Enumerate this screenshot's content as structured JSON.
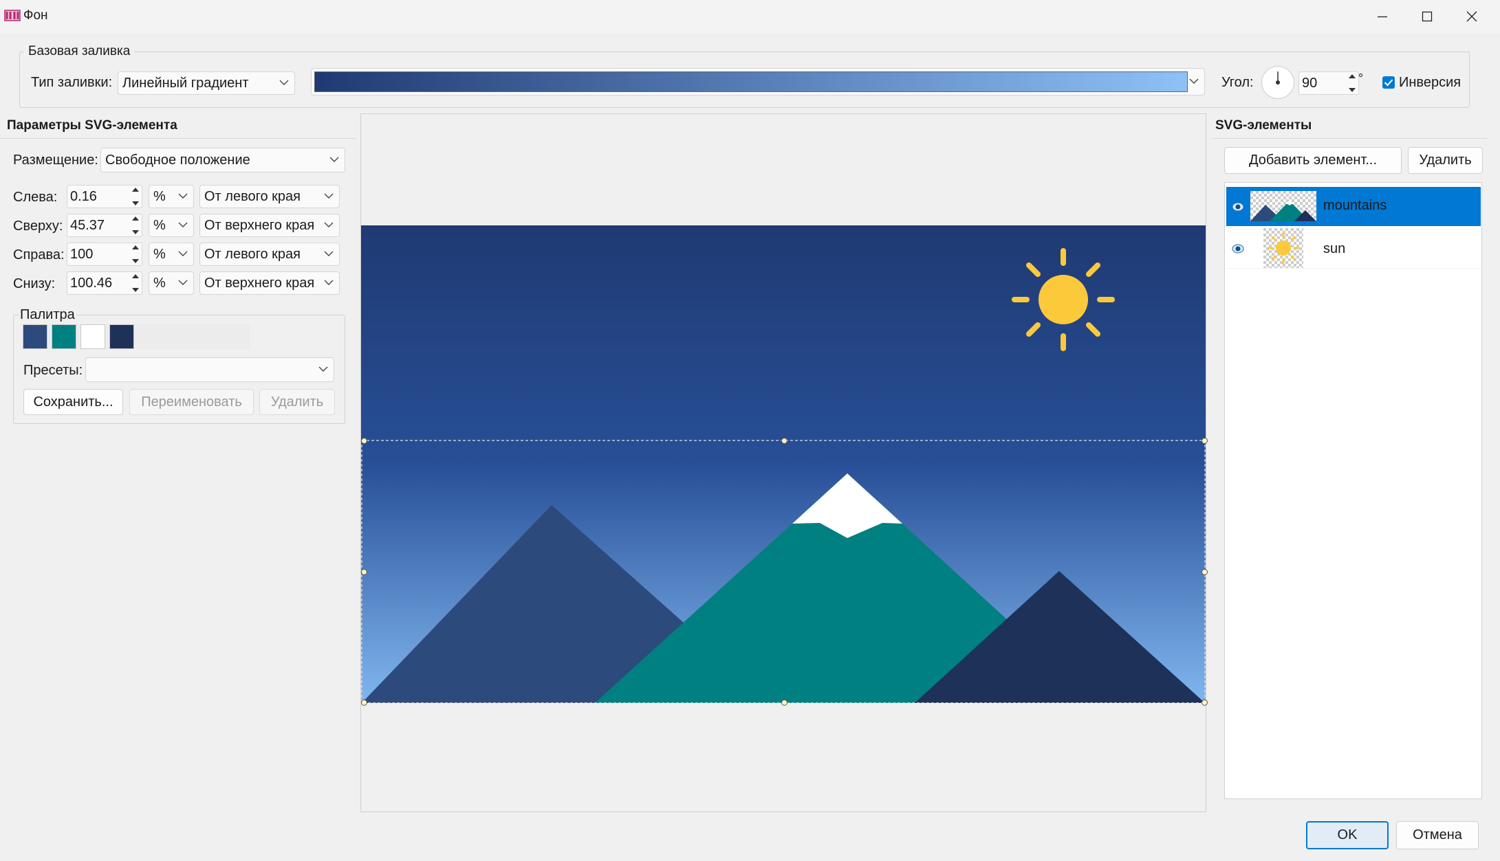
{
  "window": {
    "title": "Фон"
  },
  "base_fill": {
    "group_label": "Базовая заливка",
    "fill_type_label": "Тип заливки:",
    "fill_type_value": "Линейный градиент",
    "gradient_colors": [
      "#1f3a73",
      "#8ec1f5"
    ],
    "angle_label": "Угол:",
    "angle_value": "90",
    "angle_unit": "°",
    "invert_label": "Инверсия",
    "invert_checked": true
  },
  "svg_params": {
    "title": "Параметры SVG-элемента",
    "placement_label": "Размещение:",
    "placement_value": "Свободное положение",
    "rows": [
      {
        "label": "Слева:",
        "value": "0.16",
        "unit": "%",
        "anchor": "От левого края"
      },
      {
        "label": "Сверху:",
        "value": "45.37",
        "unit": "%",
        "anchor": "От верхнего края"
      },
      {
        "label": "Справа:",
        "value": "100",
        "unit": "%",
        "anchor": "От левого края"
      },
      {
        "label": "Снизу:",
        "value": "100.46",
        "unit": "%",
        "anchor": "От верхнего края"
      }
    ],
    "palette": {
      "label": "Палитра",
      "colors": [
        "#2d4a7c",
        "#008080",
        "#ffffff",
        "#1e3158"
      ],
      "presets_label": "Пресеты:",
      "presets_value": "",
      "save_label": "Сохранить...",
      "rename_label": "Переименовать",
      "delete_label": "Удалить"
    }
  },
  "svg_elements": {
    "title": "SVG-элементы",
    "add_label": "Добавить элемент...",
    "delete_label": "Удалить",
    "items": [
      {
        "name": "mountains",
        "visible": true,
        "selected": true
      },
      {
        "name": "sun",
        "visible": true,
        "selected": false
      }
    ]
  },
  "preview": {
    "colors": {
      "sky_top": "#1f3a73",
      "sky_mid": "#284f97",
      "sky_bottom": "#80b6ef",
      "mountain_left": "#2d4a7c",
      "mountain_center": "#008080",
      "mountain_right": "#1e3158",
      "snow": "#ffffff",
      "sun": "#fcc93a"
    }
  },
  "footer": {
    "ok_label": "OK",
    "cancel_label": "Отмена"
  },
  "accent": "#0078d4"
}
